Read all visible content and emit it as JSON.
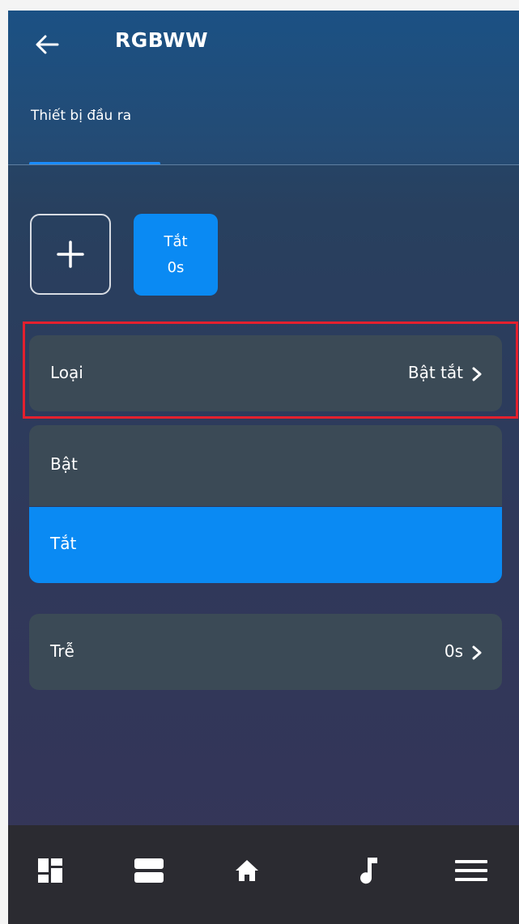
{
  "header": {
    "title": "RGBWW",
    "back_icon": "arrow-left-icon"
  },
  "tabs": [
    {
      "label": "Thiết bị đầu ra",
      "active": true
    }
  ],
  "actions": {
    "add_icon": "plus-icon",
    "step_chip": {
      "state": "Tắt",
      "delay": "0s"
    }
  },
  "settings": {
    "type_row": {
      "label": "Loại",
      "value": "Bật tắt"
    },
    "options": [
      {
        "label": "Bật",
        "selected": false
      },
      {
        "label": "Tắt",
        "selected": true
      }
    ],
    "delay_row": {
      "label": "Trễ",
      "value": "0s"
    }
  },
  "bottom_nav": {
    "items": [
      "dashboard-icon",
      "rooms-icon",
      "home-icon",
      "music-icon",
      "menu-icon"
    ]
  },
  "colors": {
    "accent": "#0a8af3",
    "row_bg": "#3b4a56",
    "nav_bg": "#2b2b31",
    "highlight": "#e4202e"
  }
}
